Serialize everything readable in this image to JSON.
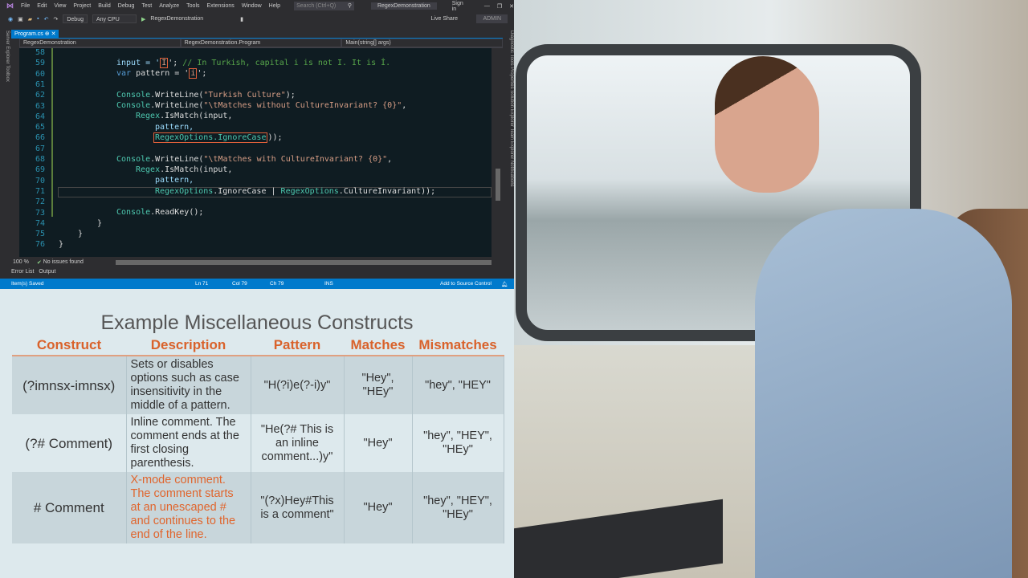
{
  "ide": {
    "menu": [
      "File",
      "Edit",
      "View",
      "Project",
      "Build",
      "Debug",
      "Test",
      "Analyze",
      "Tools",
      "Extensions",
      "Window",
      "Help"
    ],
    "search_placeholder": "Search (Ctrl+Q)",
    "solution_name": "RegexDemonstration",
    "sign_in": "Sign in",
    "config": "Debug",
    "platform": "Any CPU",
    "start_target": "RegexDemonstration",
    "live_share": "Live Share",
    "admin": "ADMIN",
    "left_side_tabs": "Server Explorer   Toolbox",
    "right_side_tabs": "Diagnostic Tools   Properties   Solution Explorer   Team Explorer   Notifications",
    "tab": "Program.cs",
    "nav": [
      "RegexDemonstration",
      "RegexDemonstration.Program",
      "Main(string[] args)"
    ],
    "line_numbers": [
      "58",
      "59",
      "60",
      "61",
      "62",
      "63",
      "64",
      "65",
      "66",
      "67",
      "68",
      "69",
      "70",
      "71",
      "72",
      "73",
      "74",
      "75",
      "76"
    ],
    "zoom": "100 %",
    "issues": "No issues found",
    "bottom_tabs": [
      "Error List",
      "Output"
    ],
    "status": {
      "saved": "Item(s) Saved",
      "ln": "Ln 71",
      "col": "Col 79",
      "ch": "Ch 79",
      "mode": "INS",
      "source_control": "Add to Source Control"
    }
  },
  "code": {
    "l59a": "input = '",
    "l59b": "İ",
    "l59c": "';",
    "l59d": " // In Turkish, capital i is not I. It is İ.",
    "l60a": "var",
    "l60b": " pattern = '",
    "l60c": "i",
    "l60d": "';",
    "l62a": "Console",
    "l62b": ".WriteLine(",
    "l62c": "\"Turkish Culture\"",
    "l62d": ");",
    "l63a": "Console",
    "l63b": ".WriteLine(",
    "l63c": "\"\\tMatches without CultureInvariant? {0}\"",
    "l63d": ",",
    "l64a": "Regex",
    "l64b": ".IsMatch(input,",
    "l65": "pattern,",
    "l66a": "RegexOptions.IgnoreCase",
    "l66b": "));",
    "l68a": "Console",
    "l68b": ".WriteLine(",
    "l68c": "\"\\tMatches with CultureInvariant? {0}\"",
    "l68d": ",",
    "l69a": "Regex",
    "l69b": ".IsMatch(input,",
    "l70": "pattern,",
    "l71a": "RegexOptions",
    "l71b": ".IgnoreCase | ",
    "l71c": "RegexOptions",
    "l71d": ".CultureInvariant));",
    "l73a": "Console",
    "l73b": ".ReadKey();",
    "l74": "}",
    "l75": "}",
    "l76": "}"
  },
  "slide": {
    "title": "Example Miscellaneous Constructs",
    "headers": [
      "Construct",
      "Description",
      "Pattern",
      "Matches",
      "Mismatches"
    ],
    "rows": [
      [
        "(?imnsx-imnsx)",
        "Sets or disables options such as case insensitivity in the middle of a pattern.",
        "\"H(?i)e(?-i)y\"",
        "\"Hey\", \"HEy\"",
        "\"hey\", \"HEY\""
      ],
      [
        "(?# Comment)",
        "Inline comment. The comment ends at the first closing parenthesis.",
        "\"He(?# This is an inline comment...)y\"",
        "\"Hey\"",
        "\"hey\", \"HEY\", \"HEy\""
      ],
      [
        "# Comment",
        "X-mode comment. The comment starts at an unescaped # and continues to the end of the line.",
        "\"(?x)Hey#This is a comment\"",
        "\"Hey\"",
        "\"hey\", \"HEY\", \"HEy\""
      ]
    ]
  }
}
